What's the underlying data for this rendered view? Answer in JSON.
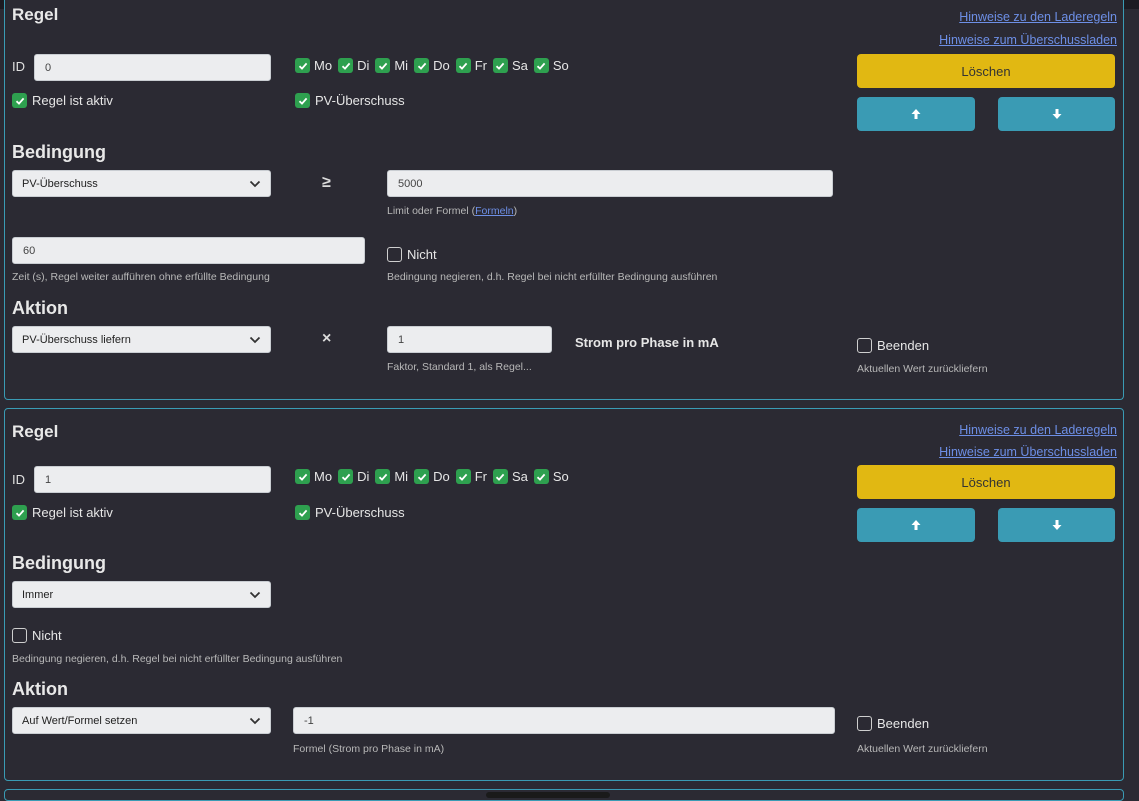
{
  "colors": {
    "accent": "#3a9bb4",
    "danger": "#e1b812",
    "check": "#2ea04f",
    "link": "#6d8fe6"
  },
  "rules": [
    {
      "title": "Regel",
      "links": [
        "Hinweise zu den Laderegeln",
        "Hinweise zum Überschussladen"
      ],
      "id_label": "ID",
      "id_value": "0",
      "days": [
        {
          "label": "Mo",
          "checked": true
        },
        {
          "label": "Di",
          "checked": true
        },
        {
          "label": "Mi",
          "checked": true
        },
        {
          "label": "Do",
          "checked": true
        },
        {
          "label": "Fr",
          "checked": true
        },
        {
          "label": "Sa",
          "checked": true
        },
        {
          "label": "So",
          "checked": true
        }
      ],
      "active_label": "Regel ist aktiv",
      "pv_label": "PV-Überschuss",
      "delete_label": "Löschen",
      "condition_heading": "Bedingung",
      "condition_select": "PV-Überschuss",
      "operator": "≥",
      "limit_value": "5000",
      "limit_help": "Limit oder Formel (",
      "limit_help_link": "Formeln",
      "limit_help_end": ")",
      "time_value": "60",
      "time_help": "Zeit (s), Regel weiter aufführen ohne erfüllte Bedingung",
      "not_label": "Nicht",
      "not_help": "Bedingung negieren, d.h. Regel bei nicht erfüllter Bedingung ausführen",
      "action_heading": "Aktion",
      "action_select": "PV-Überschuss liefern",
      "action_operator": "×",
      "factor_value": "1",
      "factor_help": "Faktor, Standard 1, als Regel...",
      "unit_label": "Strom pro Phase in mA",
      "end_label": "Beenden",
      "end_help": "Aktuellen Wert zurückliefern"
    },
    {
      "title": "Regel",
      "links": [
        "Hinweise zu den Laderegeln",
        "Hinweise zum Überschussladen"
      ],
      "id_label": "ID",
      "id_value": "1",
      "days": [
        {
          "label": "Mo",
          "checked": true
        },
        {
          "label": "Di",
          "checked": true
        },
        {
          "label": "Mi",
          "checked": true
        },
        {
          "label": "Do",
          "checked": true
        },
        {
          "label": "Fr",
          "checked": true
        },
        {
          "label": "Sa",
          "checked": true
        },
        {
          "label": "So",
          "checked": true
        }
      ],
      "active_label": "Regel ist aktiv",
      "pv_label": "PV-Überschuss",
      "delete_label": "Löschen",
      "condition_heading": "Bedingung",
      "condition_select": "Immer",
      "not_label": "Nicht",
      "not_help": "Bedingung negieren, d.h. Regel bei nicht erfüllter Bedingung ausführen",
      "action_heading": "Aktion",
      "action_select": "Auf Wert/Formel setzen",
      "formula_value": "-1",
      "formula_help": "Formel (Strom pro Phase in mA)",
      "end_label": "Beenden",
      "end_help": "Aktuellen Wert zurückliefern"
    }
  ]
}
